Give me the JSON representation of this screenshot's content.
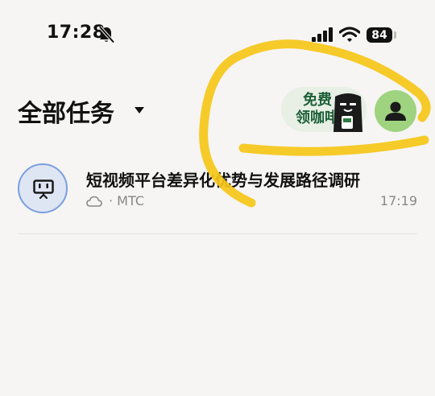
{
  "status_bar": {
    "time": "17:28",
    "battery": "84",
    "icons": [
      "bell-slash-icon",
      "cellular-signal-icon",
      "wifi-icon",
      "battery-icon"
    ]
  },
  "header": {
    "title": "全部任务",
    "dropdown_icon": "caret-down-icon"
  },
  "promo": {
    "line1": "免费",
    "line2": "领咖啡",
    "mascot_icon": "coffee-mascot-icon"
  },
  "avatar": {
    "icon": "user-icon",
    "color": "#9fd37f"
  },
  "tasks": [
    {
      "title": "短视频平台差异化优势与发展路径调研",
      "source_icon": "cloud-icon",
      "source": "· MTC",
      "time": "17:19",
      "icon": "presentation-board-icon"
    }
  ],
  "colors": {
    "background": "#f6f5f3",
    "promo_bg": "#e8f0e6",
    "promo_text": "#1d5f37",
    "annotation": "#f5c518",
    "task_icon_ring": "#7a9fe0"
  }
}
